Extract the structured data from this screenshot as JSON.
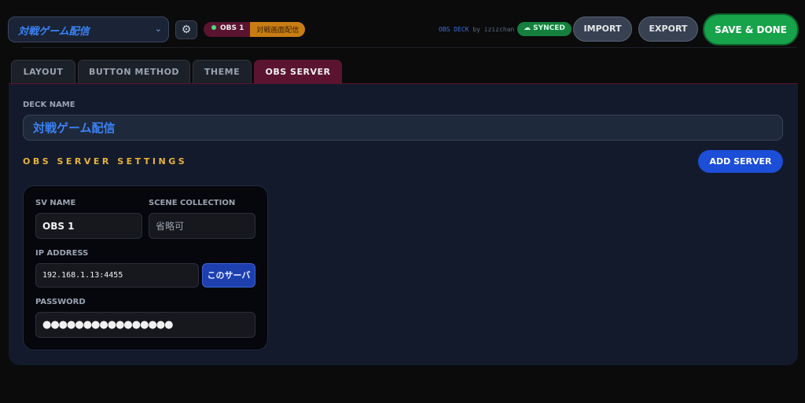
{
  "header": {
    "deck_select_value": "対戦ゲーム配信",
    "chevron": "⌄",
    "gear": "⚙",
    "status_badge": {
      "server": "OBS 1",
      "scene": "対戦画面配信"
    },
    "credit_app": "OBS DECK",
    "credit_by": " by izizchan",
    "synced_label": "☁ SYNCED",
    "import_label": "IMPORT",
    "export_label": "EXPORT",
    "save_label": "SAVE & DONE"
  },
  "tabs": [
    {
      "label": "LAYOUT"
    },
    {
      "label": "BUTTON METHOD"
    },
    {
      "label": "THEME"
    },
    {
      "label": "OBS SERVER",
      "active": true
    }
  ],
  "panel": {
    "deck_name_label": "DECK NAME",
    "deck_name_value": "対戦ゲーム配信",
    "section_title": "OBS SERVER SETTINGS",
    "add_server_label": "ADD SERVER",
    "server": {
      "sv_name_label": "SV NAME",
      "sv_name_value": "OBS 1",
      "scene_collection_label": "SCENE COLLECTION",
      "scene_collection_placeholder": "省略可",
      "ip_label": "IP ADDRESS",
      "ip_value": "192.168.1.13:4455",
      "this_server_label": "このサーバ",
      "password_label": "PASSWORD",
      "password_masked": "●●●●●●●●●●●●●●●●"
    }
  }
}
